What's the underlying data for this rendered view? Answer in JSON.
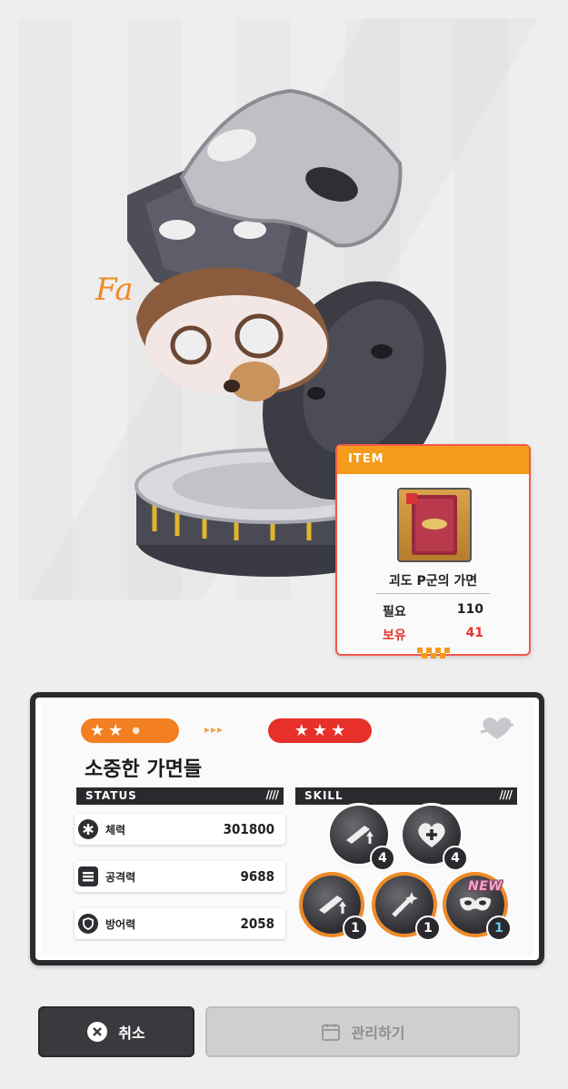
{
  "item_popup": {
    "header": "ITEM",
    "name": "괴도 P군의 가면",
    "required_label": "필요",
    "required_value": "110",
    "owned_label": "보유",
    "owned_value": "41",
    "icon": "mask-book-icon",
    "owned_color": "#e5352c",
    "header_color": "#f49b1a"
  },
  "card": {
    "current_stars": 2,
    "next_stars": 3,
    "title": "소중한 가면들",
    "status_label": "STATUS",
    "skill_label": "SKILL",
    "stats": [
      {
        "label": "체력",
        "value": "301800",
        "icon": "asterisk-icon"
      },
      {
        "label": "공격력",
        "value": "9688",
        "icon": "list-icon"
      },
      {
        "label": "방어력",
        "value": "2058",
        "icon": "shield-icon"
      }
    ],
    "skills": [
      {
        "icon": "weapon-up-icon",
        "level": "4"
      },
      {
        "icon": "heart-plus-icon",
        "level": "4"
      },
      {
        "icon": "weapon-up-icon",
        "level": "1"
      },
      {
        "icon": "wand-icon",
        "level": "1"
      },
      {
        "icon": "mask-icon",
        "level": "1",
        "badge": "NEW"
      }
    ]
  },
  "buttons": {
    "cancel": "취소",
    "manage": "관리하기"
  }
}
